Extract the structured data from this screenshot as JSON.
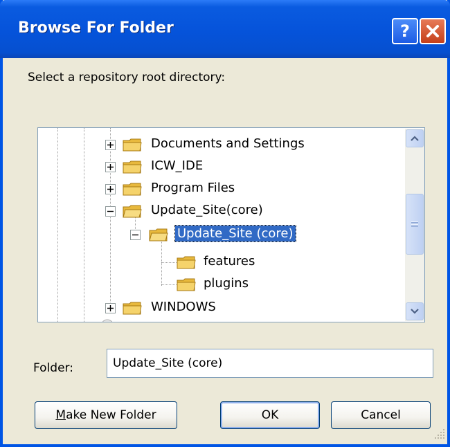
{
  "window": {
    "title": "Browse For Folder",
    "help_glyph": "?",
    "close_glyph": "close-icon"
  },
  "prompt": "Select a repository root directory:",
  "tree": {
    "items": [
      {
        "label": "Documents and Settings",
        "expander": "+",
        "depth": 1
      },
      {
        "label": "ICW_IDE",
        "expander": "+",
        "depth": 1
      },
      {
        "label": "Program Files",
        "expander": "+",
        "depth": 1
      },
      {
        "label": "Update_Site(core)",
        "expander": "-",
        "depth": 1
      },
      {
        "label": "Update_Site (core)",
        "expander": "-",
        "depth": 2,
        "selected": true
      },
      {
        "label": "features",
        "expander": "",
        "depth": 3
      },
      {
        "label": "plugins",
        "expander": "",
        "depth": 3
      },
      {
        "label": "WINDOWS",
        "expander": "+",
        "depth": 1
      }
    ]
  },
  "folder_field": {
    "label": "Folder:",
    "value": "Update_Site (core)"
  },
  "buttons": {
    "make_new_folder": "Make New Folder",
    "ok": "OK",
    "cancel": "Cancel"
  },
  "colors": {
    "titlebar": "#0553DA",
    "selection": "#316AC5",
    "dialog_bg": "#ECE9D8",
    "folder_yellow": "#F5D36B"
  }
}
